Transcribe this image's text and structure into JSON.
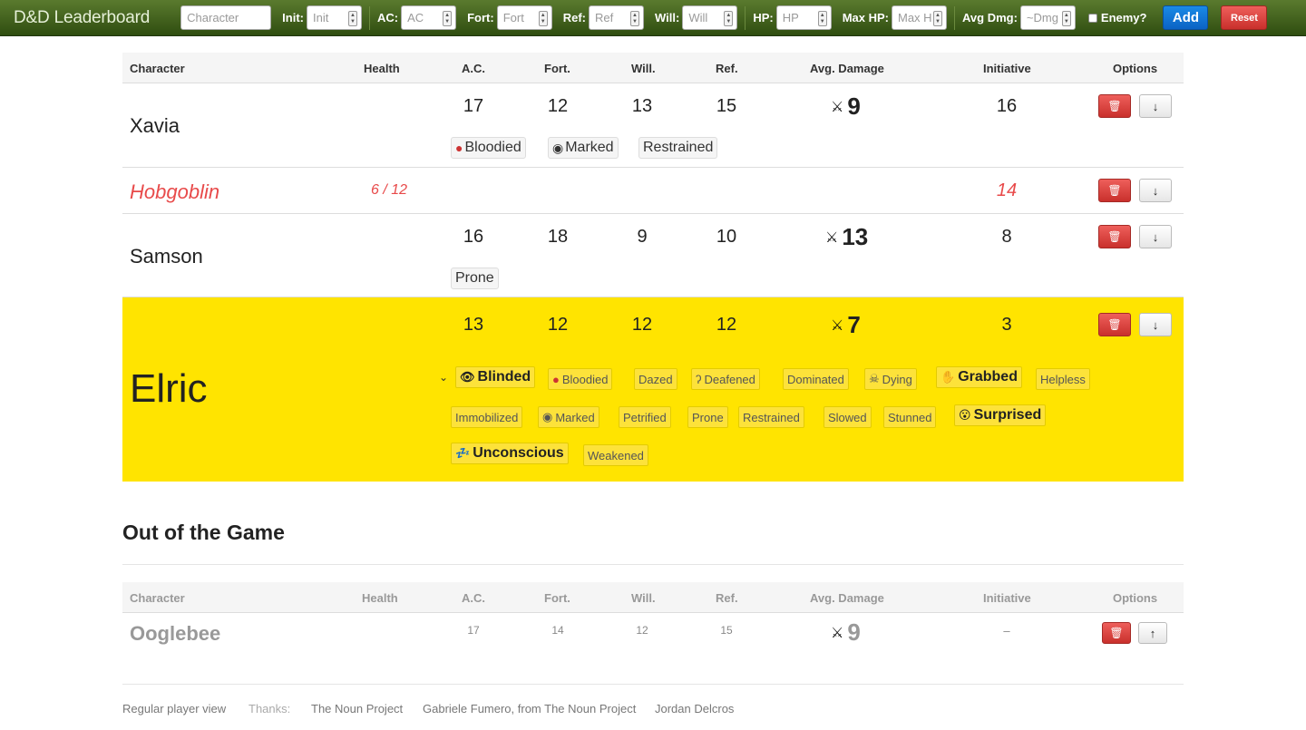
{
  "app": {
    "title": "D&D Leaderboard"
  },
  "form": {
    "character_placeholder": "Character",
    "init_label": "Init:",
    "init_placeholder": "Init",
    "ac_label": "AC:",
    "ac_placeholder": "AC",
    "fort_label": "Fort:",
    "fort_placeholder": "Fort",
    "ref_label": "Ref:",
    "ref_placeholder": "Ref",
    "will_label": "Will:",
    "will_placeholder": "Will",
    "hp_label": "HP:",
    "hp_placeholder": "HP",
    "maxhp_label": "Max HP:",
    "maxhp_placeholder": "Max H",
    "avgdmg_label": "Avg Dmg:",
    "avgdmg_placeholder": "~Dmg",
    "enemy_label": "Enemy?",
    "add_label": "Add",
    "reset_label": "Reset"
  },
  "columns": [
    "Character",
    "Health",
    "A.C.",
    "Fort.",
    "Will.",
    "Ref.",
    "Avg. Damage",
    "Initiative",
    "Options"
  ],
  "players": [
    {
      "name": "Xavia",
      "health": "",
      "ac": "17",
      "fort": "12",
      "will": "13",
      "ref": "15",
      "avg_damage": "9",
      "initiative": "16",
      "conditions": [
        "Bloodied",
        "Marked",
        "Restrained"
      ]
    },
    {
      "name": "Hobgoblin",
      "health": "6 / 12",
      "ac": "",
      "fort": "",
      "will": "",
      "ref": "",
      "avg_damage": "",
      "initiative": "14",
      "conditions": []
    },
    {
      "name": "Samson",
      "health": "",
      "ac": "16",
      "fort": "18",
      "will": "9",
      "ref": "10",
      "avg_damage": "13",
      "initiative": "8",
      "conditions": [
        "Prone"
      ]
    },
    {
      "name": "Elric",
      "health": "",
      "ac": "13",
      "fort": "12",
      "will": "12",
      "ref": "12",
      "avg_damage": "7",
      "initiative": "3",
      "conditions": [
        "Blinded",
        "Bloodied",
        "Dazed",
        "Deafened",
        "Dominated",
        "Dying",
        "Grabbed",
        "Helpless",
        "Immobilized",
        "Marked",
        "Petrified",
        "Prone",
        "Restrained",
        "Slowed",
        "Stunned",
        "Surprised",
        "Unconscious",
        "Weakened"
      ]
    }
  ],
  "out_of_game": {
    "title": "Out of the Game",
    "players": [
      {
        "name": "Ooglebee",
        "health": "",
        "ac": "17",
        "fort": "14",
        "will": "12",
        "ref": "15",
        "avg_damage": "9",
        "initiative": "–"
      }
    ]
  },
  "footer": {
    "view_link": "Regular player view",
    "thanks_label": "Thanks:",
    "credit1": "The Noun Project",
    "credit2": "Gabriele Fumero, from The Noun Project",
    "credit3": "Jordan Delcros"
  },
  "colors": {
    "topbar": "#3f5f1c",
    "enemy": "#e84a4a",
    "highlight": "#ffe400",
    "add": "#0b63c4",
    "delete": "#d9413d"
  }
}
